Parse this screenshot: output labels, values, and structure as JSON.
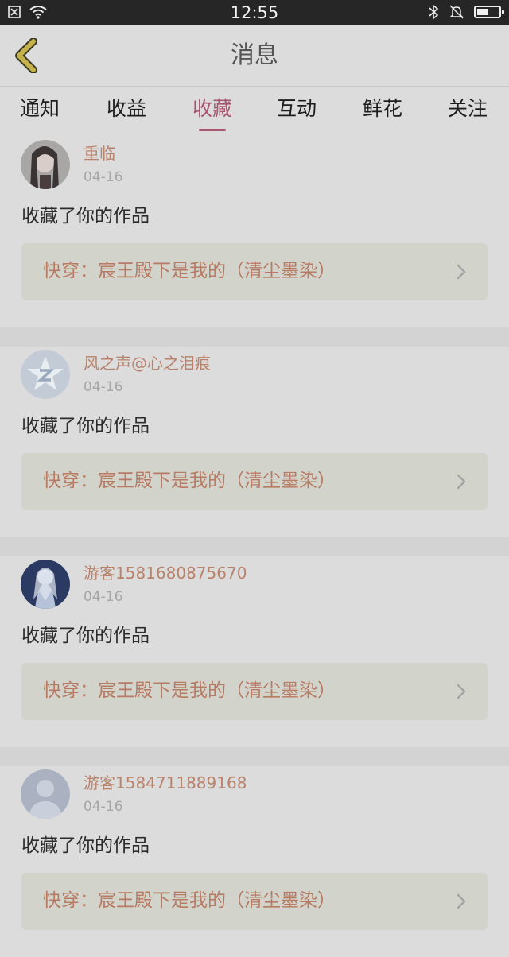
{
  "status_bar": {
    "time": "12:55",
    "battery_level": 0.55
  },
  "header": {
    "title": "消息",
    "back_icon": "chevron-left-icon"
  },
  "tabs": [
    {
      "label": "通知"
    },
    {
      "label": "收益"
    },
    {
      "label": "收藏"
    },
    {
      "label": "互动"
    },
    {
      "label": "鲜花"
    },
    {
      "label": "关注"
    }
  ],
  "active_tab": "收藏",
  "items": [
    {
      "username": "重临",
      "date": "04-16",
      "action": "收藏了你的作品",
      "work_title": "快穿：宸王殿下是我的（清尘墨染）"
    },
    {
      "username": "风之声@心之泪痕",
      "date": "04-16",
      "action": "收藏了你的作品",
      "work_title": "快穿：宸王殿下是我的（清尘墨染）"
    },
    {
      "username": "游客1581680875670",
      "date": "04-16",
      "action": "收藏了你的作品",
      "work_title": "快穿：宸王殿下是我的（清尘墨染）"
    },
    {
      "username": "游客1584711889168",
      "date": "04-16",
      "action": "收藏了你的作品",
      "work_title": "快穿：宸王殿下是我的（清尘墨染）"
    }
  ],
  "colors": {
    "accent": "#a8556f",
    "username": "#b9826a",
    "back_icon": "#c6b24a"
  }
}
